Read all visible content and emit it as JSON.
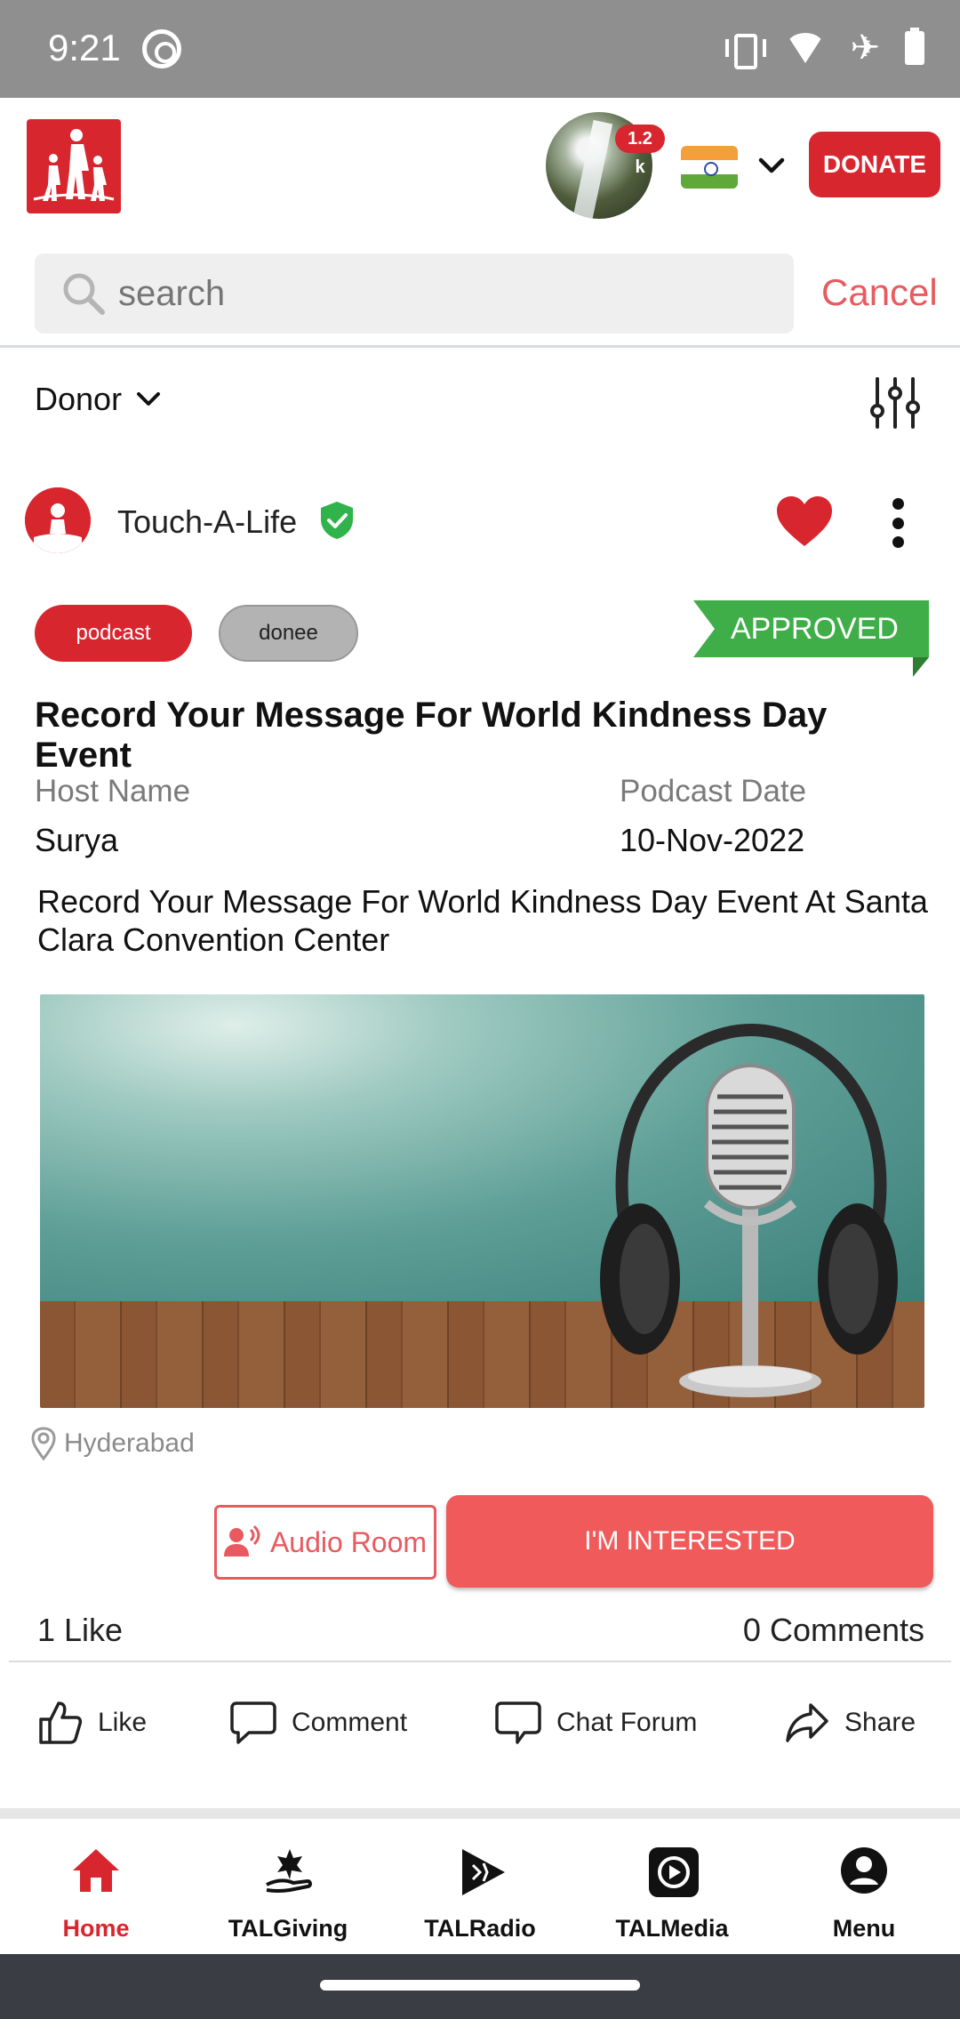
{
  "status_bar": {
    "time": "9:21"
  },
  "header": {
    "avatar_badge": "1.2 k",
    "donate_label": "DONATE"
  },
  "search": {
    "placeholder": "search",
    "cancel_label": "Cancel"
  },
  "filter": {
    "selected": "Donor"
  },
  "post": {
    "org_name": "Touch-A-Life",
    "tags": [
      "podcast",
      "donee"
    ],
    "status": "APPROVED",
    "title": "Record Your Message For World Kindness Day Event",
    "host_label": "Host Name",
    "host_value": "Surya",
    "date_label": "Podcast Date",
    "date_value": "10-Nov-2022",
    "description": "Record Your Message For World Kindness Day Event At Santa Clara Convention Center",
    "location": "Hyderabad",
    "audio_room_label": "Audio Room",
    "interested_label": "I'M INTERESTED",
    "likes_count": "1 Like",
    "comments_count": "0 Comments"
  },
  "actions": [
    "Like",
    "Comment",
    "Chat Forum",
    "Share"
  ],
  "bottom_nav": [
    "Home",
    "TALGiving",
    "TALRadio",
    "TALMedia",
    "Menu"
  ],
  "colors": {
    "brand_red": "#d8262f",
    "approved_green": "#3fae49",
    "interested": "#f05a5a"
  }
}
